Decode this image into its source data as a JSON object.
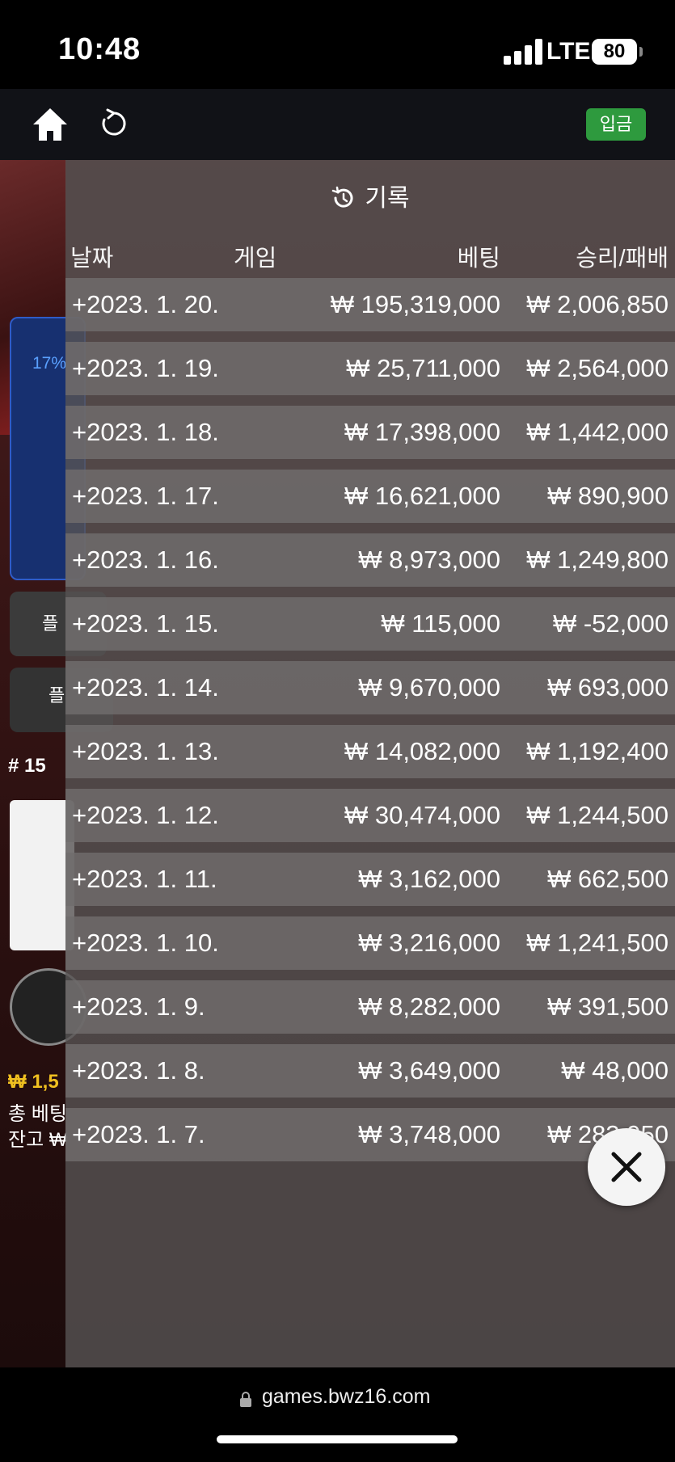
{
  "status_bar": {
    "time": "10:48",
    "network": "LTE",
    "battery": "80"
  },
  "top_bar": {
    "deposit_label": "입금"
  },
  "game_background": {
    "progress_percent": "17%",
    "round_label": "# 15",
    "balance_line_1": "₩ 1,5",
    "total_bet_line": "총 베팅",
    "balance_line_3": "잔고 ₩"
  },
  "history": {
    "title": "기록",
    "columns": {
      "date": "날짜",
      "game": "게임",
      "bet": "베팅",
      "win_loss": "승리/패배"
    },
    "rows": [
      {
        "date": "+2023. 1. 20.",
        "bet": "₩ 195,319,000",
        "win_loss": "₩ 2,006,850"
      },
      {
        "date": "+2023. 1. 19.",
        "bet": "₩ 25,711,000",
        "win_loss": "₩ 2,564,000"
      },
      {
        "date": "+2023. 1. 18.",
        "bet": "₩ 17,398,000",
        "win_loss": "₩ 1,442,000"
      },
      {
        "date": "+2023. 1. 17.",
        "bet": "₩ 16,621,000",
        "win_loss": "₩ 890,900"
      },
      {
        "date": "+2023. 1. 16.",
        "bet": "₩ 8,973,000",
        "win_loss": "₩ 1,249,800"
      },
      {
        "date": "+2023. 1. 15.",
        "bet": "₩ 115,000",
        "win_loss": "₩ -52,000"
      },
      {
        "date": "+2023. 1. 14.",
        "bet": "₩ 9,670,000",
        "win_loss": "₩ 693,000"
      },
      {
        "date": "+2023. 1. 13.",
        "bet": "₩ 14,082,000",
        "win_loss": "₩ 1,192,400"
      },
      {
        "date": "+2023. 1. 12.",
        "bet": "₩ 30,474,000",
        "win_loss": "₩ 1,244,500"
      },
      {
        "date": "+2023. 1. 11.",
        "bet": "₩ 3,162,000",
        "win_loss": "₩ 662,500"
      },
      {
        "date": "+2023. 1. 10.",
        "bet": "₩ 3,216,000",
        "win_loss": "₩ 1,241,500"
      },
      {
        "date": "+2023. 1. 9.",
        "bet": "₩ 8,282,000",
        "win_loss": "₩ 391,500"
      },
      {
        "date": "+2023. 1. 8.",
        "bet": "₩ 3,649,000",
        "win_loss": "₩ 48,000"
      },
      {
        "date": "+2023. 1. 7.",
        "bet": "₩ 3,748,000",
        "win_loss": "₩ 283,950"
      }
    ]
  },
  "browser": {
    "url": "games.bwz16.com"
  },
  "colors": {
    "deposit_green": "#2e9a3e",
    "panel_bg": "#585454",
    "row_bg": "#706c6c"
  }
}
